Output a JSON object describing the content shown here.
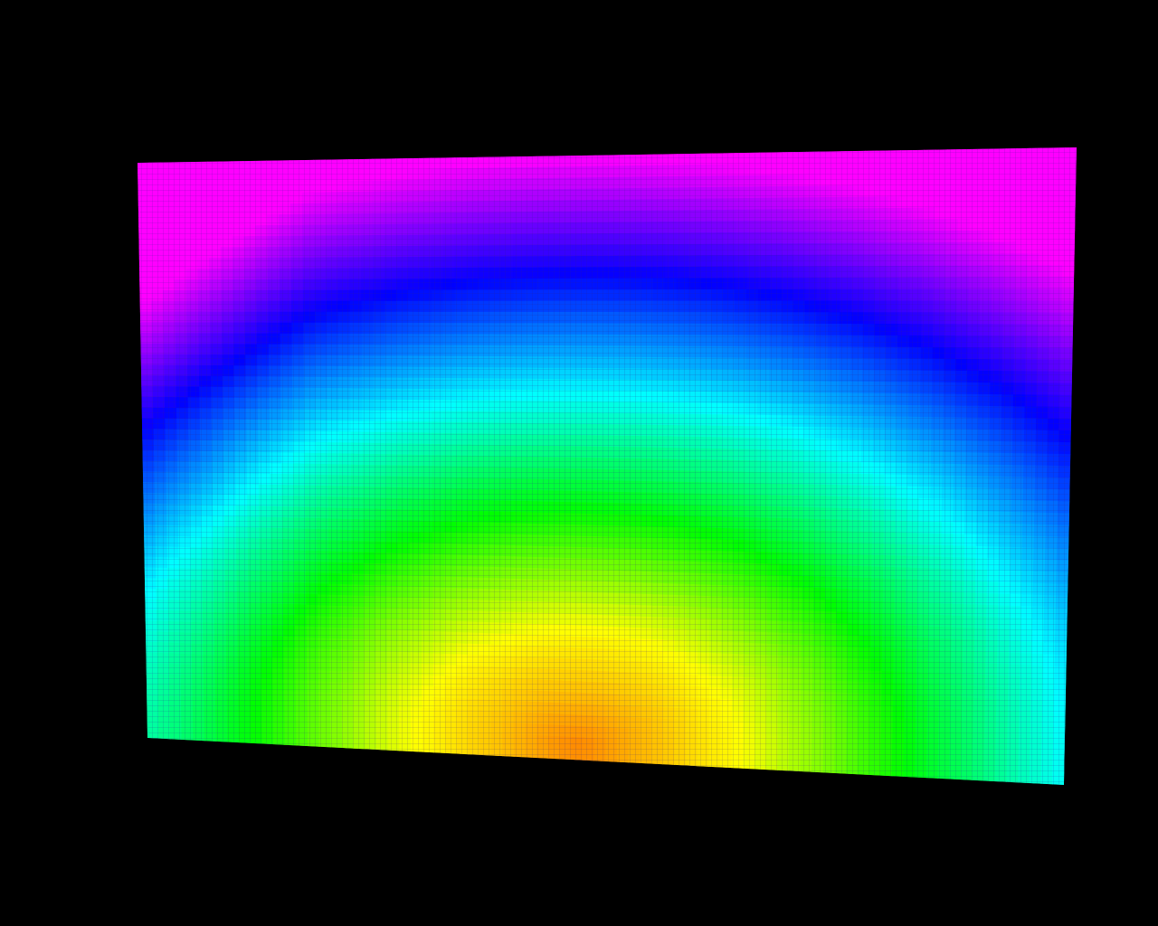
{
  "scene": {
    "background_color": "#000000",
    "object": "point-cloud-surface",
    "colormap": "rainbow",
    "colormap_stops": [
      "#ff00ff",
      "#0000ff",
      "#00ffff",
      "#00ff00",
      "#ffff00",
      "#ff8800"
    ],
    "peak_color": "#ff8800",
    "edge_color_corners": "#ff00ff",
    "grid_line_color": "#2a1a8a"
  }
}
